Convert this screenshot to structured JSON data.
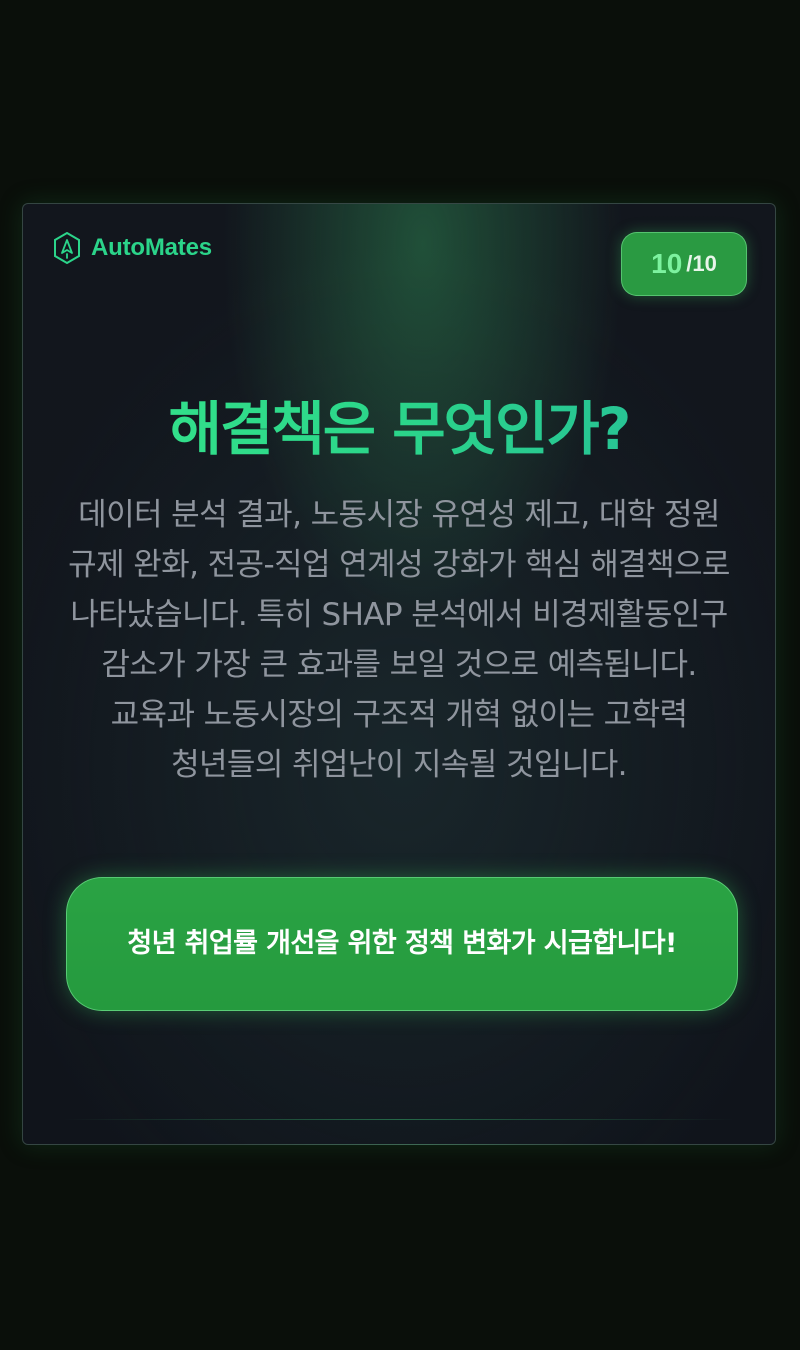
{
  "brand": {
    "name": "AutoMates",
    "icon": "automates-logo-icon"
  },
  "pagination": {
    "current": "10",
    "total": "/10"
  },
  "slide": {
    "title": "해결책은 무엇인가?",
    "body": "데이터 분석 결과, 노동시장 유연성 제고, 대학 정원 규제 완화, 전공-직업 연계성 강화가 핵심 해결책으로 나타났습니다. 특히 SHAP 분석에서 비경제활동인구 감소가 가장 큰 효과를 보일 것으로 예측됩니다. 교육과 노동시장의 구조적 개혁 없이는 고학력 청년들의 취업난이 지속될 것입니다.",
    "cta": "청년 취업률 개선을 위한 정책 변화가 시급합니다!"
  },
  "colors": {
    "page_background": "#0a0f0a",
    "card_background": "#11151c",
    "accent_green": "#2bd48a",
    "button_green": "#2a9a42",
    "body_text": "#8f959e"
  }
}
